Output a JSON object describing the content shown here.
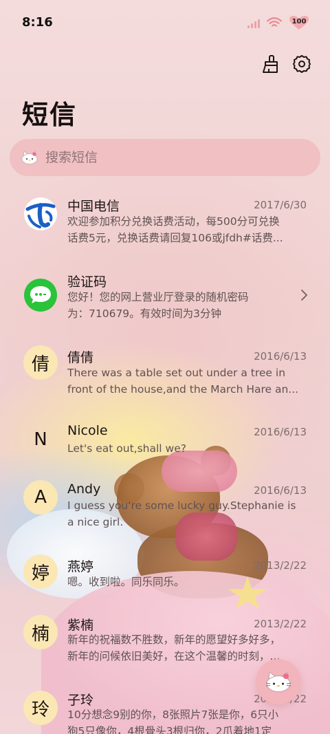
{
  "status_bar": {
    "time": "8:16",
    "battery": "100",
    "icons": [
      "signal-icon",
      "wifi-icon",
      "battery-icon"
    ]
  },
  "header": {
    "title": "短信",
    "actions": [
      "broom-icon",
      "gear-icon"
    ]
  },
  "search": {
    "placeholder": "搜索短信",
    "icon": "hello-kitty-icon"
  },
  "messages": [
    {
      "name": "中国电信",
      "date": "2017/6/30",
      "avatar": "china-telecom-logo",
      "preview": [
        "欢迎参加积分兑换话费活动，每500分可兑换",
        "话费5元，兑换话费请回复106或jfdh#话费..."
      ]
    },
    {
      "name": "验证码",
      "date": "",
      "avatar": "message-bubble-icon",
      "preview": [
        "您好！您的网上营业厅登录的随机密码",
        "为：710679。有效时间为3分钟"
      ]
    },
    {
      "name": "倩倩",
      "date": "2016/6/13",
      "avatar_text": "倩",
      "preview": [
        "There was a table set out under a tree in",
        "front of the house,and the March Hare an..."
      ]
    },
    {
      "name": "Nicole",
      "date": "2016/6/13",
      "avatar_text": "N",
      "preview": [
        "Let's eat out,shall we?"
      ]
    },
    {
      "name": "Andy",
      "date": "2016/6/13",
      "avatar_text": "A",
      "preview": [
        "I guess you're some lucky guy.Stephanie is",
        "a nice girl."
      ]
    },
    {
      "name": "燕婷",
      "date": "2013/2/22",
      "avatar_text": "婷",
      "preview": [
        "嗯。收到啦。同乐同乐。"
      ]
    },
    {
      "name": "紫楠",
      "date": "2013/2/22",
      "avatar_text": "楠",
      "preview": [
        "新年的祝福数不胜数，新年的愿望好多好多，",
        "新年的问候依旧美好，在这个温馨的时刻，..."
      ]
    },
    {
      "name": "子玲",
      "date": "2013/2/22",
      "avatar_text": "玲",
      "preview": [
        "10分想念9别的你，8张照片7张是你，6只小",
        "狗5只像你，4根骨头3根归你，2爪着地1定"
      ]
    }
  ],
  "fab": {
    "icon": "hello-kitty-compose-icon"
  },
  "colors": {
    "background": "#f3dada",
    "search_bg": "#f0c0c3",
    "avatar_bg": "#fae7b4",
    "telecom_blue": "#1a5fc6",
    "sms_green": "#2ac33a"
  }
}
